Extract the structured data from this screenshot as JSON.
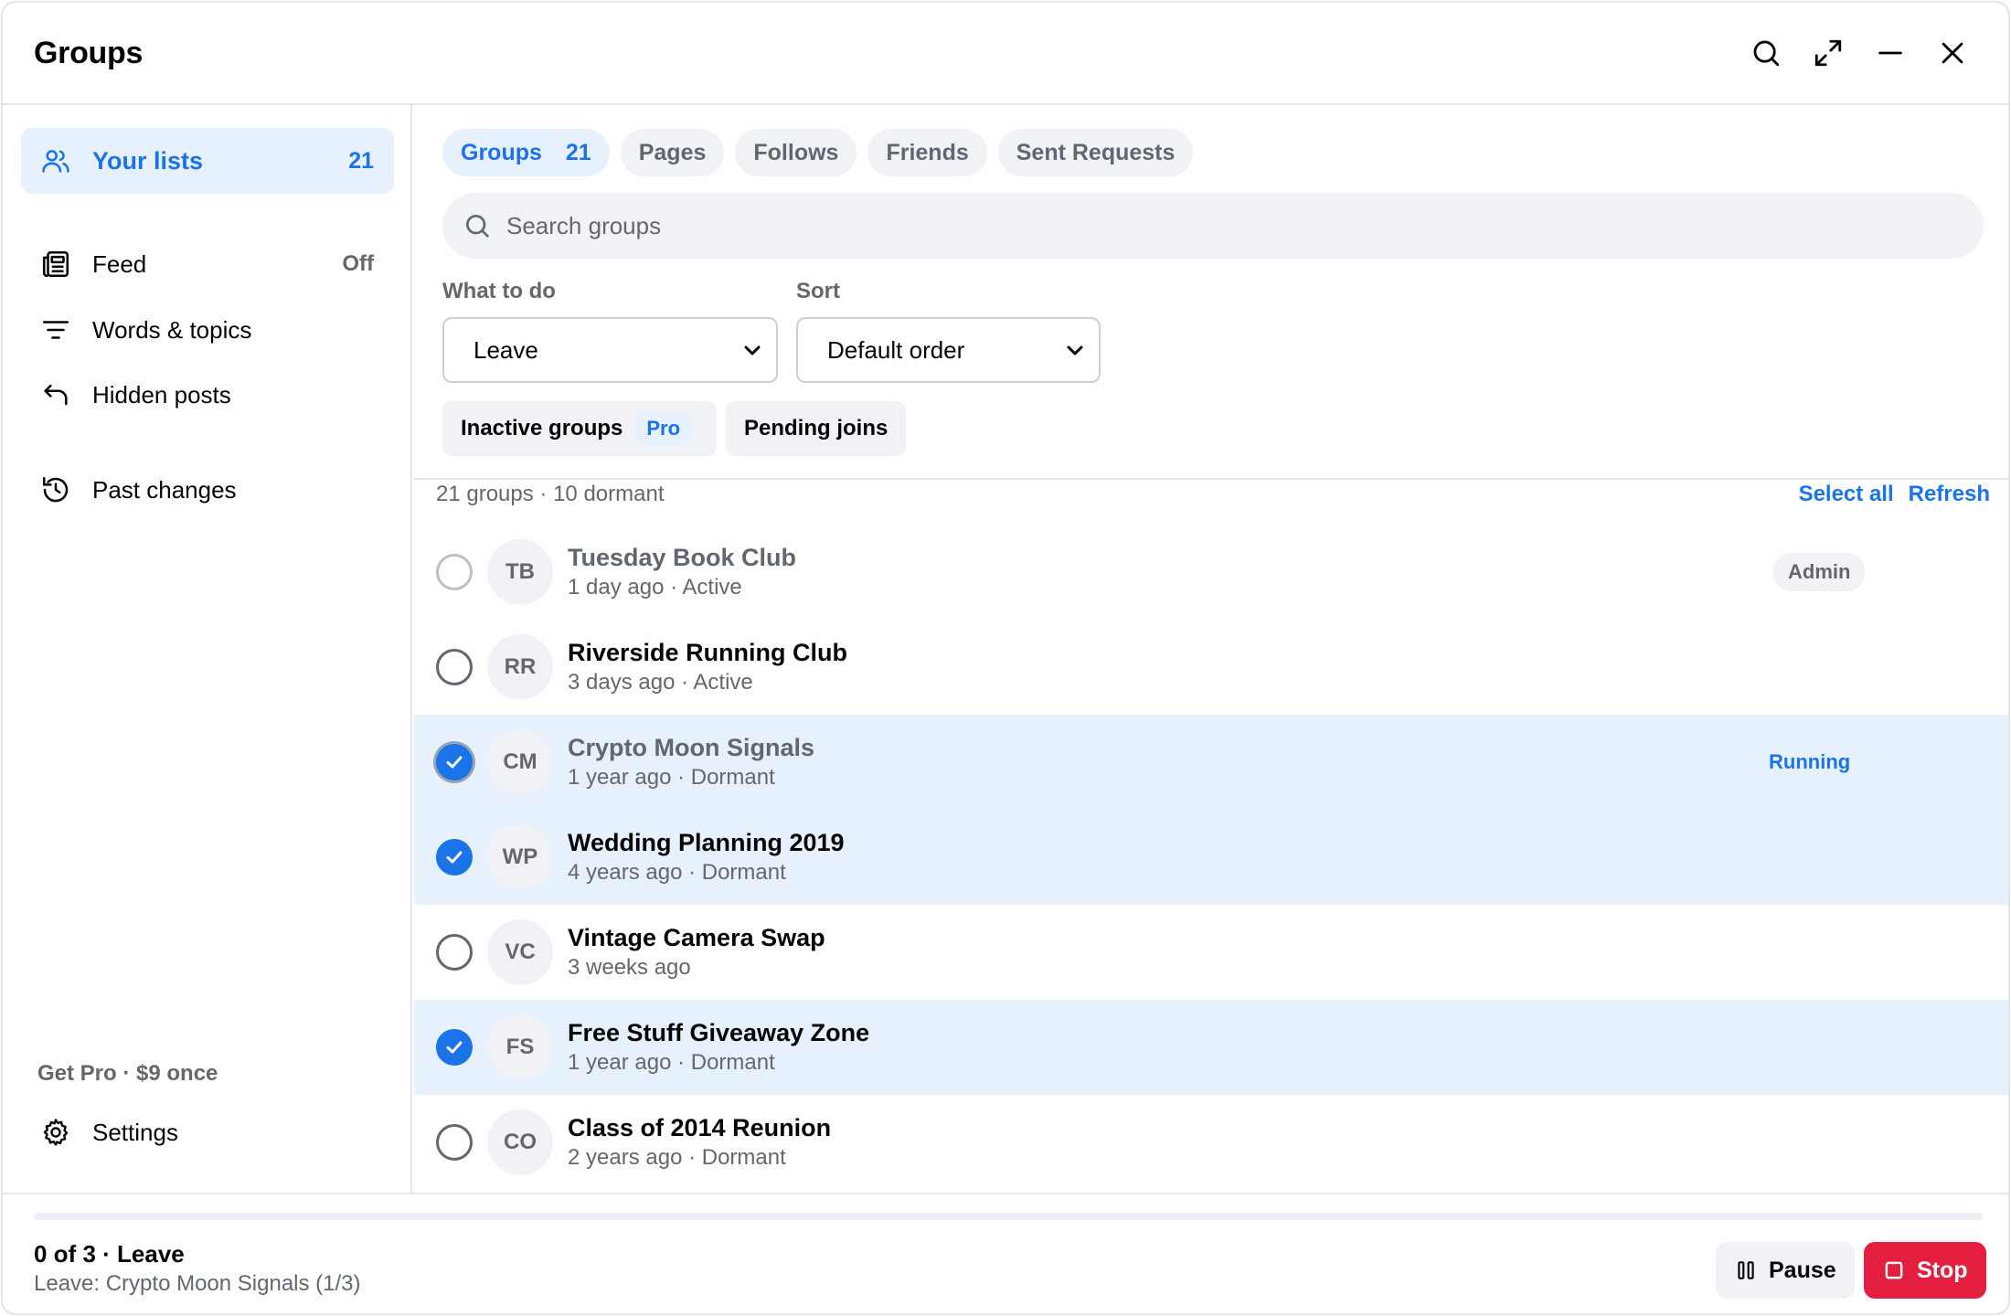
{
  "header": {
    "title": "Groups"
  },
  "sidebar": {
    "your_lists": {
      "label": "Your lists",
      "count": "21"
    },
    "items": [
      {
        "label": "Feed",
        "value": "Off"
      },
      {
        "label": "Words & topics"
      },
      {
        "label": "Hidden posts"
      },
      {
        "label": "Past changes"
      }
    ],
    "get_pro": "Get Pro · $9 once",
    "settings": "Settings"
  },
  "tabs": [
    {
      "label": "Groups",
      "count": "21"
    },
    {
      "label": "Pages"
    },
    {
      "label": "Follows"
    },
    {
      "label": "Friends"
    },
    {
      "label": "Sent Requests"
    }
  ],
  "search": {
    "placeholder": "Search groups"
  },
  "what_to_do": {
    "label": "What to do",
    "value": "Leave"
  },
  "sort": {
    "label": "Sort",
    "value": "Default order"
  },
  "filters": {
    "inactive": "Inactive groups",
    "pro": "Pro",
    "pending": "Pending joins"
  },
  "list": {
    "summary": "21 groups · 10 dormant",
    "select_all": "Select all",
    "refresh": "Refresh",
    "rows": [
      {
        "initials": "TB",
        "name": "Tuesday Book Club",
        "meta": "1 day ago · Active",
        "badge": "Admin"
      },
      {
        "initials": "RR",
        "name": "Riverside Running Club",
        "meta": "3 days ago · Active"
      },
      {
        "initials": "CM",
        "name": "Crypto Moon Signals",
        "meta": "1 year ago · Dormant",
        "status": "Running"
      },
      {
        "initials": "WP",
        "name": "Wedding Planning 2019",
        "meta": "4 years ago · Dormant"
      },
      {
        "initials": "VC",
        "name": "Vintage Camera Swap",
        "meta": "3 weeks ago"
      },
      {
        "initials": "FS",
        "name": "Free Stuff Giveaway Zone",
        "meta": "1 year ago · Dormant"
      },
      {
        "initials": "CO",
        "name": "Class of 2014 Reunion",
        "meta": "2 years ago · Dormant"
      }
    ]
  },
  "footer": {
    "progress_fraction": 0,
    "status": "0 of 3 · Leave",
    "detail": "Leave: Crypto Moon Signals (1/3)",
    "pause": "Pause",
    "stop": "Stop"
  },
  "colors": {
    "accent": "#1a73e8",
    "accent_bg": "#e7f0fd",
    "danger": "#e41e3f",
    "muted": "#65676b"
  }
}
